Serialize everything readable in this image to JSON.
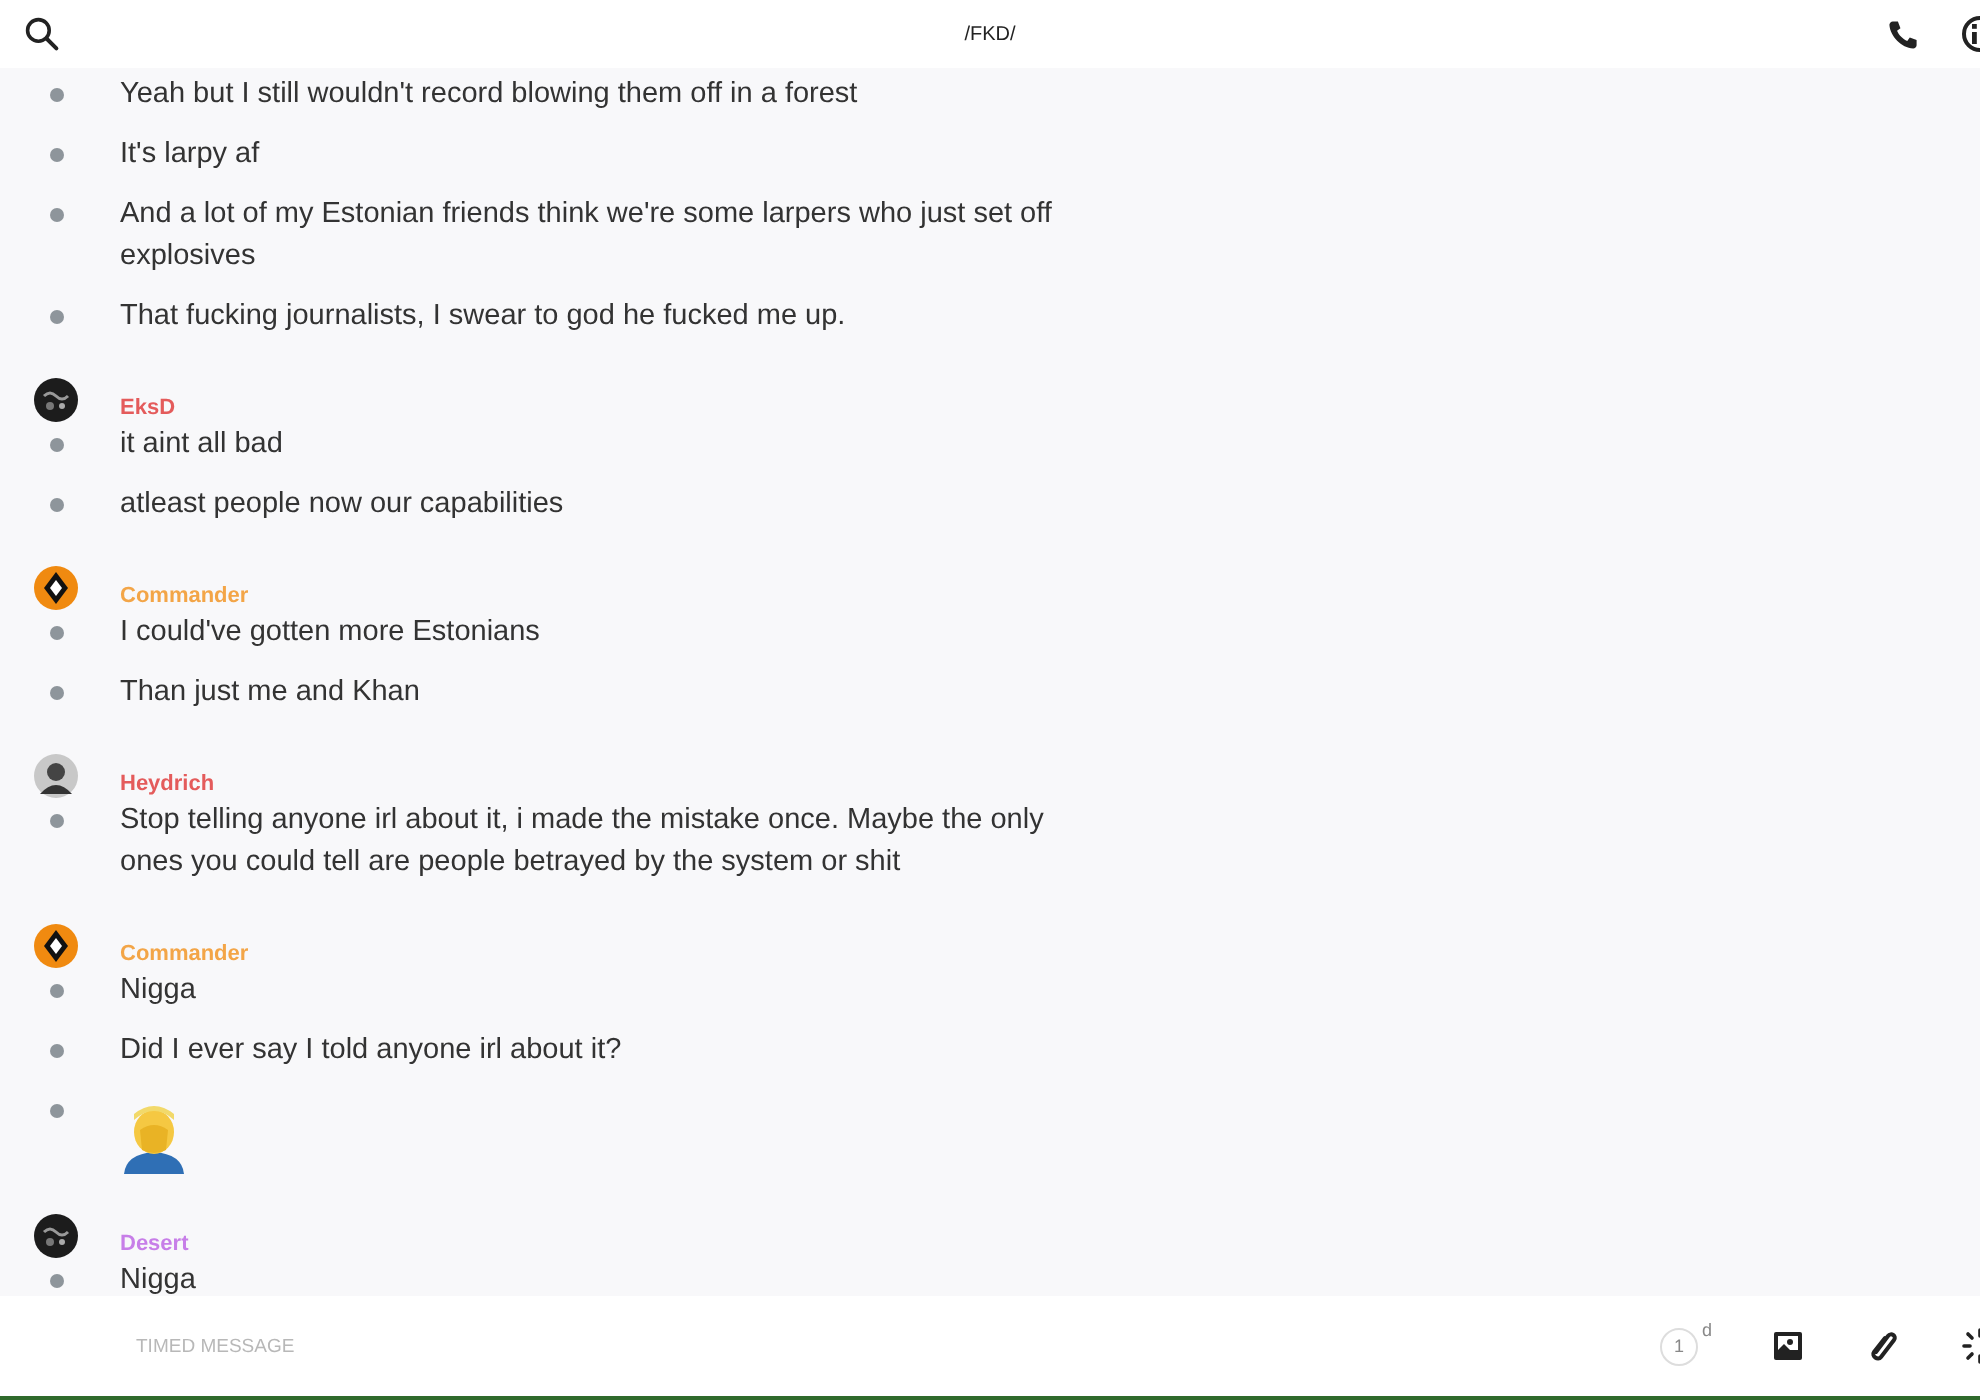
{
  "header": {
    "title": "/FKD/"
  },
  "groups": [
    {
      "messages": [
        {
          "kind": "text",
          "text": "Yeah but I still wouldn't record blowing them off in a forest"
        },
        {
          "kind": "text",
          "text": "It's larpy af"
        },
        {
          "kind": "text",
          "text": "And a lot of my Estonian friends think we're some larpers who just set off explosives"
        },
        {
          "kind": "text",
          "text": "That fucking journalists, I swear to god he fucked me up."
        }
      ]
    },
    {
      "sender": "EksD",
      "color": "#e45b5b",
      "avatar": {
        "kind": "dark"
      },
      "messages": [
        {
          "kind": "text",
          "text": "it aint all bad"
        },
        {
          "kind": "text",
          "text": "atleast people now our capabilities"
        }
      ]
    },
    {
      "sender": "Commander",
      "color": "#f3a547",
      "avatar": {
        "kind": "diamond"
      },
      "messages": [
        {
          "kind": "text",
          "text": "I could've gotten more Estonians"
        },
        {
          "kind": "text",
          "text": "Than just me and Khan"
        }
      ]
    },
    {
      "sender": "Heydrich",
      "color": "#e45b5b",
      "avatar": {
        "kind": "person"
      },
      "messages": [
        {
          "kind": "text",
          "text": "Stop telling anyone irl about it, i made the mistake once. Maybe the only ones you could tell are people betrayed by the system or shit"
        }
      ]
    },
    {
      "sender": "Commander",
      "color": "#f3a547",
      "avatar": {
        "kind": "diamond"
      },
      "messages": [
        {
          "kind": "text",
          "text": "Nigga"
        },
        {
          "kind": "text",
          "text": "Did I ever say I told anyone irl about it?"
        },
        {
          "kind": "emoji"
        }
      ]
    },
    {
      "sender": "Desert",
      "color": "#c77ee8",
      "avatar": {
        "kind": "dark"
      },
      "messages": [
        {
          "kind": "text",
          "text": "Nigga"
        }
      ]
    }
  ],
  "composer": {
    "placeholder": "TIMED MESSAGE",
    "timer_value": "1",
    "timer_unit": "d"
  }
}
